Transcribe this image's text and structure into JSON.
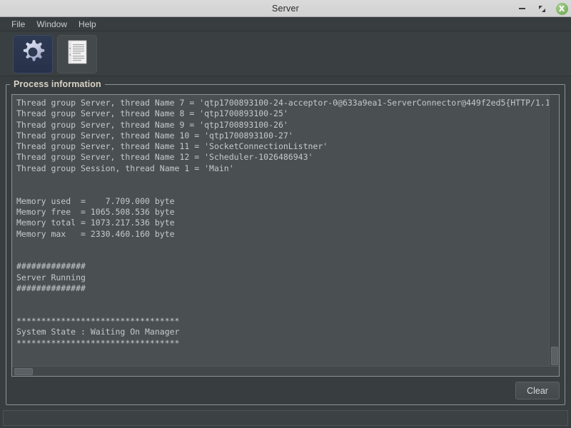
{
  "window": {
    "title": "Server",
    "controls": {
      "minimize": "minimize-icon",
      "maximize": "maximize-icon",
      "close_glyph": "X"
    }
  },
  "menubar": {
    "items": [
      {
        "label": "File"
      },
      {
        "label": "Window"
      },
      {
        "label": "Help"
      }
    ]
  },
  "toolbar": {
    "buttons": [
      {
        "name": "settings-gear-icon",
        "selected": true
      },
      {
        "name": "document-icon",
        "selected": false
      }
    ]
  },
  "groupbox": {
    "label": "Process information"
  },
  "log": {
    "text": "Thread group Server, thread Name 7 = 'qtp1700893100-24-acceptor-0@633a9ea1-ServerConnector@449f2ed5{HTTP/1.1\nThread group Server, thread Name 8 = 'qtp1700893100-25'\nThread group Server, thread Name 9 = 'qtp1700893100-26'\nThread group Server, thread Name 10 = 'qtp1700893100-27'\nThread group Server, thread Name 11 = 'SocketConnectionListner'\nThread group Server, thread Name 12 = 'Scheduler-1026486943'\nThread group Session, thread Name 1 = 'Main'\n\n\nMemory used  =    7.709.000 byte\nMemory free  = 1065.508.536 byte\nMemory total = 1073.217.536 byte\nMemory max   = 2330.460.160 byte\n\n\n##############\nServer Running\n##############\n\n\n*********************************\nSystem State : Waiting On Manager\n*********************************",
    "lines": [
      "Thread group Server, thread Name 7 = 'qtp1700893100-24-acceptor-0@633a9ea1-ServerConnector@449f2ed5{HTTP/1.1",
      "Thread group Server, thread Name 8 = 'qtp1700893100-25'",
      "Thread group Server, thread Name 9 = 'qtp1700893100-26'",
      "Thread group Server, thread Name 10 = 'qtp1700893100-27'",
      "Thread group Server, thread Name 11 = 'SocketConnectionListner'",
      "Thread group Server, thread Name 12 = 'Scheduler-1026486943'",
      "Thread group Session, thread Name 1 = 'Main'",
      "",
      "",
      "Memory used  =    7.709.000 byte",
      "Memory free  = 1065.508.536 byte",
      "Memory total = 1073.217.536 byte",
      "Memory max   = 2330.460.160 byte",
      "",
      "",
      "##############",
      "Server Running",
      "##############",
      "",
      "",
      "*********************************",
      "System State : Waiting On Manager",
      "*********************************"
    ],
    "memory": {
      "used": "7.709.000 byte",
      "free": "1065.508.536 byte",
      "total": "1073.217.536 byte",
      "max": "2330.460.160 byte"
    },
    "server_status": "Server Running",
    "system_state": "System State : Waiting On Manager"
  },
  "buttons": {
    "clear": "Clear"
  },
  "statusbar": {
    "text": ""
  },
  "colors": {
    "window_bg": "#383d40",
    "titlebar_bg": "#d6d6d6",
    "text_area_bg": "#4a4f52",
    "log_text": "#c5c9cb",
    "group_label": "#d9d2c4",
    "close_button": "#7cb05e",
    "selected_tool_bg": "#2e3a52"
  }
}
